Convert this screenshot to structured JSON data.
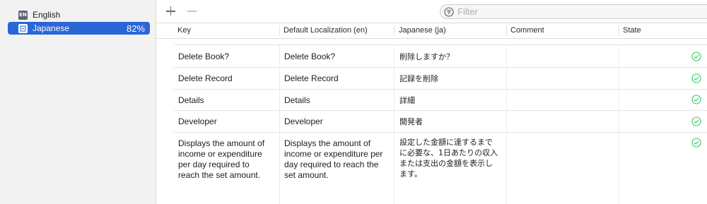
{
  "sidebar": {
    "languages": [
      {
        "code": "EN",
        "name": "English",
        "percent": "",
        "selected": false
      },
      {
        "code": "",
        "name": "Japanese",
        "percent": "82%",
        "selected": true
      }
    ]
  },
  "toolbar": {
    "add_icon": "plus-icon",
    "remove_icon": "minus-icon",
    "filter_placeholder": "Filter",
    "filter_icon": "filter-icon"
  },
  "table": {
    "columns": [
      "Key",
      "Default Localization (en)",
      "Japanese (ja)",
      "Comment",
      "State"
    ],
    "rows": [
      {
        "key": "Delete Book?",
        "default": "Delete Book?",
        "ja": "削除しますか？",
        "comment": "",
        "state": "checkmark-circle-icon"
      },
      {
        "key": "Delete Record",
        "default": "Delete Record",
        "ja": "記録を削除",
        "comment": "",
        "state": "checkmark-circle-icon"
      },
      {
        "key": "Details",
        "default": "Details",
        "ja": "詳細",
        "comment": "",
        "state": "checkmark-circle-icon"
      },
      {
        "key": "Developer",
        "default": "Developer",
        "ja": "開発者",
        "comment": "",
        "state": "checkmark-circle-icon"
      },
      {
        "key": "Displays the amount of income or expenditure per day required to reach the set amount.",
        "default": "Displays the amount of income or expenditure per day required to reach the set amount.",
        "ja": "設定した金額に達するまでに必要な、1日あたりの収入または支出の金額を表示します。",
        "comment": "",
        "state": "checkmark-circle-icon"
      }
    ]
  },
  "colors": {
    "accent": "#2a66d6",
    "state_ok": "#34c759"
  }
}
